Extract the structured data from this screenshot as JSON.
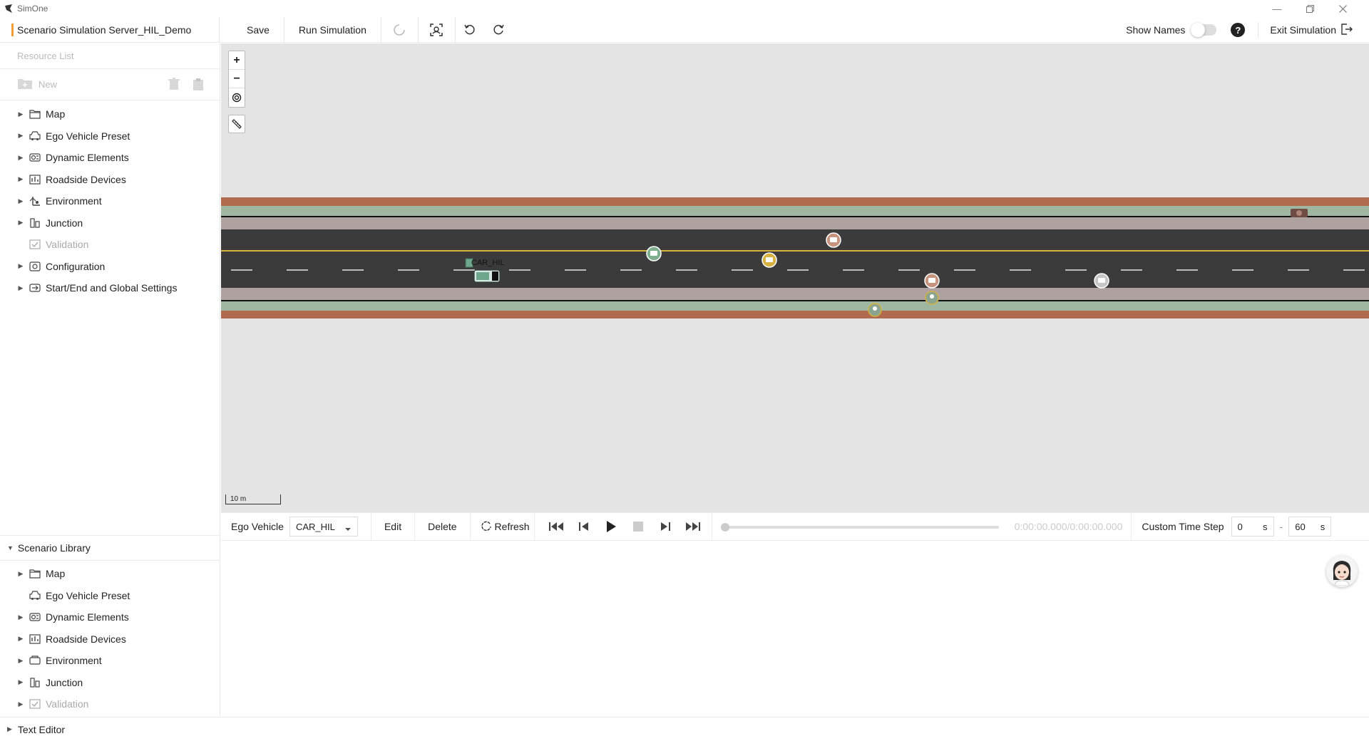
{
  "app": {
    "name": "SimOne"
  },
  "toolbar": {
    "scenario_title": "Scenario Simulation Server_HIL_Demo",
    "save_label": "Save",
    "run_label": "Run Simulation",
    "show_names_label": "Show Names",
    "show_names_on": false,
    "exit_label": "Exit Simulation",
    "help_glyph": "?"
  },
  "resource": {
    "header": "Resource List",
    "new_label": "New",
    "items": [
      {
        "label": "Map",
        "icon": "folder-icon",
        "has_children": true,
        "disabled": false
      },
      {
        "label": "Ego Vehicle Preset",
        "icon": "car-icon",
        "has_children": true,
        "disabled": false
      },
      {
        "label": "Dynamic Elements",
        "icon": "dynamic-elements-icon",
        "has_children": true,
        "disabled": false
      },
      {
        "label": "Roadside Devices",
        "icon": "roadside-device-icon",
        "has_children": true,
        "disabled": false
      },
      {
        "label": "Environment",
        "icon": "environment-icon",
        "has_children": true,
        "disabled": false
      },
      {
        "label": "Junction",
        "icon": "junction-icon",
        "has_children": true,
        "disabled": false
      },
      {
        "label": "Validation",
        "icon": "validation-icon",
        "has_children": false,
        "disabled": true
      },
      {
        "label": "Configuration",
        "icon": "configuration-icon",
        "has_children": true,
        "disabled": false
      },
      {
        "label": "Start/End and Global Settings",
        "icon": "settings-icon",
        "has_children": true,
        "disabled": false
      }
    ]
  },
  "library": {
    "header": "Scenario Library",
    "items": [
      {
        "label": "Map",
        "icon": "folder-icon",
        "has_children": true,
        "disabled": false
      },
      {
        "label": "Ego Vehicle Preset",
        "icon": "car-icon",
        "has_children": false,
        "disabled": false
      },
      {
        "label": "Dynamic Elements",
        "icon": "dynamic-elements-icon",
        "has_children": true,
        "disabled": false
      },
      {
        "label": "Roadside Devices",
        "icon": "roadside-device-icon",
        "has_children": true,
        "disabled": false
      },
      {
        "label": "Environment",
        "icon": "environment-icon",
        "has_children": true,
        "disabled": false
      },
      {
        "label": "Junction",
        "icon": "junction-icon",
        "has_children": true,
        "disabled": false
      },
      {
        "label": "Validation",
        "icon": "validation-icon",
        "has_children": true,
        "disabled": true
      }
    ]
  },
  "text_editor": {
    "label": "Text Editor"
  },
  "map": {
    "scale_label": "10 m",
    "ego_label": "CAR_HIL",
    "colors": {
      "background": "#e4e4e4",
      "curb": "#b06a4e",
      "grass": "#9fb7a0",
      "sidewalk": "#aea19f",
      "asphalt": "#3b3b3b",
      "center_line": "#d8b23a",
      "lane_dash": "#ffffff"
    }
  },
  "playback": {
    "ego_label": "Ego Vehicle",
    "ego_value": "CAR_HIL",
    "edit_label": "Edit",
    "delete_label": "Delete",
    "refresh_label": "Refresh",
    "progress": 0,
    "time_display": "0:00:00.000/0:00:00.000",
    "custom_step_label": "Custom Time Step",
    "start_value": "0",
    "start_unit": "s",
    "end_value": "60",
    "end_unit": "s"
  }
}
